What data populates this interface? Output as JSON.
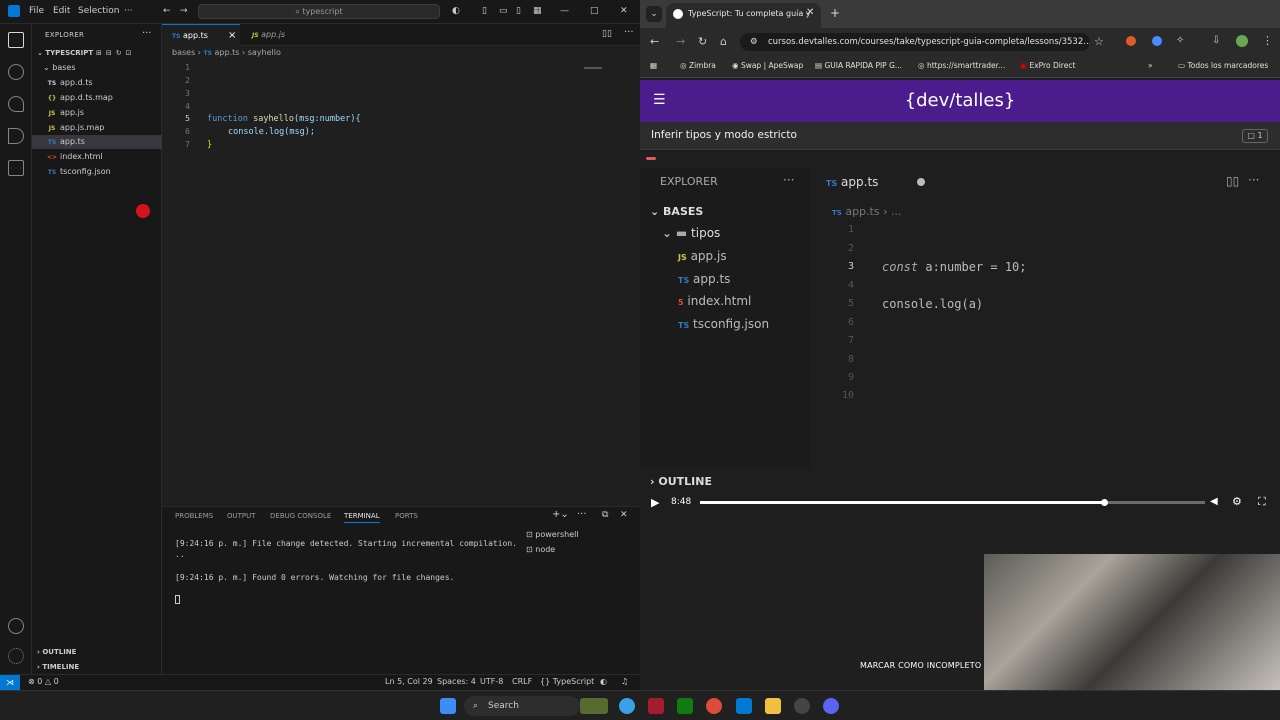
{
  "vscode": {
    "menu": [
      "File",
      "Edit",
      "Selection"
    ],
    "search_text": "typescript",
    "explorer_title": "EXPLORER",
    "workspace": "TYPESCRIPT",
    "folder": "bases",
    "files": [
      {
        "name": "app.d.ts",
        "icon": "TS",
        "color": "#3178c6"
      },
      {
        "name": "app.d.ts.map",
        "icon": "{}",
        "color": "#cbcb41"
      },
      {
        "name": "app.js",
        "icon": "JS",
        "color": "#cbcb41"
      },
      {
        "name": "app.js.map",
        "icon": "JS",
        "color": "#cbcb41"
      },
      {
        "name": "app.ts",
        "icon": "TS",
        "color": "#3178c6"
      },
      {
        "name": "index.html",
        "icon": "<>",
        "color": "#e44d26"
      },
      {
        "name": "tsconfig.json",
        "icon": "TS",
        "color": "#3178c6"
      }
    ],
    "tabs": [
      {
        "label": "app.ts",
        "icon": "TS",
        "close": "×"
      },
      {
        "label": "app.js",
        "icon": "JS"
      }
    ],
    "breadcrumb": [
      "bases",
      "app.ts",
      "sayhello"
    ],
    "line_numbers": [
      "1",
      "2",
      "3",
      "4",
      "5",
      "6",
      "7"
    ],
    "code": {
      "l5_kw": "function",
      "l5_fn": "sayhello",
      "l5_args": "(msg:number){",
      "l6": "console.log(msg);",
      "l7": "}"
    },
    "panel_tabs": [
      "PROBLEMS",
      "OUTPUT",
      "DEBUG CONSOLE",
      "TERMINAL",
      "PORTS"
    ],
    "terminal_lines": [
      "[9:24:16 p. m.] File change detected. Starting incremental compilation.",
      "..",
      "[9:24:16 p. m.] Found 0 errors. Watching for file changes."
    ],
    "terminals": [
      "powershell",
      "node"
    ],
    "outline": "OUTLINE",
    "timeline": "TIMELINE",
    "status": {
      "errors": "0",
      "warnings": "0",
      "position": "Ln 5, Col 29",
      "spaces": "Spaces: 4",
      "encoding": "UTF-8",
      "eol": "CRLF",
      "language": "TypeScript"
    }
  },
  "browser": {
    "tab_title": "TypeScript: Tu completa guía y",
    "url": "cursos.devtalles.com/courses/take/typescript-guia-completa/lessons/3532...",
    "bookmarks": [
      "Zimbra",
      "Swap | ApeSwap",
      "GUIA RAPIDA PIP G...",
      "https://smarttrader...",
      "ExPro Direct",
      "Todos los marcadores"
    ],
    "site_logo": "{dev/talles}",
    "lesson_title": "Inferir tipos y modo estricto",
    "comment_count": "1",
    "video": {
      "explorer_title": "EXPLORER",
      "tab": "app.ts",
      "breadcrumb": "app.ts",
      "folder_root": "BASES",
      "folder_sub": "tipos",
      "files": [
        {
          "name": "app.js",
          "icon": "JS",
          "color": "#cbcb41"
        },
        {
          "name": "app.ts",
          "icon": "TS",
          "color": "#3178c6"
        },
        {
          "name": "index.html",
          "icon": "5",
          "color": "#e44d26"
        },
        {
          "name": "tsconfig.json",
          "icon": "TS",
          "color": "#3178c6"
        }
      ],
      "line_numbers": [
        "1",
        "2",
        "3",
        "4",
        "5",
        "6",
        "7",
        "8",
        "9",
        "10"
      ],
      "code_l3_kw": "const",
      "code_l3_rest": "a:number = 10;",
      "code_l5": "console.log(a)",
      "outline": "OUTLINE",
      "time": "8:48",
      "progress": 0.8
    },
    "incomplete_button": "MARCAR COMO INCOMPLETO"
  },
  "taskbar": {
    "search": "Search"
  },
  "colors": {
    "accent": "#0078d4",
    "devtalles": "#4a1c8c",
    "keyword": "#569cd6",
    "function": "#dcdcaa",
    "type": "#4ec9b0"
  }
}
